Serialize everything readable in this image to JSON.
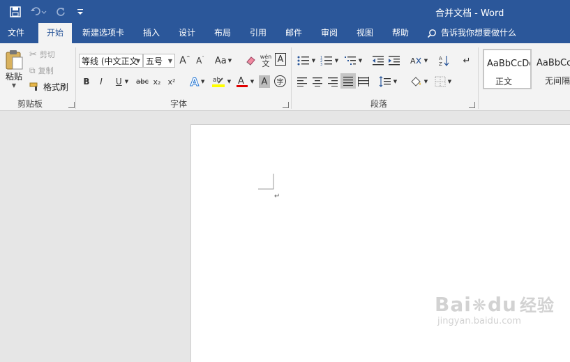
{
  "window": {
    "title": "合并文档  -  Word"
  },
  "qat": {
    "save_icon": "save-icon",
    "undo_icon": "undo-icon",
    "redo_icon": "redo-icon",
    "customize_icon": "customize-qat-icon"
  },
  "tabs": [
    {
      "label": "文件"
    },
    {
      "label": "开始",
      "active": true
    },
    {
      "label": "新建选项卡"
    },
    {
      "label": "插入"
    },
    {
      "label": "设计"
    },
    {
      "label": "布局"
    },
    {
      "label": "引用"
    },
    {
      "label": "邮件"
    },
    {
      "label": "审阅"
    },
    {
      "label": "视图"
    },
    {
      "label": "帮助"
    }
  ],
  "tellme": {
    "label": "告诉我你想要做什么"
  },
  "clipboard": {
    "paste_label": "粘贴",
    "cut_label": "剪切",
    "copy_label": "复制",
    "format_painter_label": "格式刷",
    "group_label": "剪贴板"
  },
  "font": {
    "font_name": "等线 (中文正文",
    "font_size": "五号",
    "change_case": "Aa",
    "phonetic_top": "wén",
    "phonetic_bottom": "文",
    "border_char": "A",
    "bold": "B",
    "italic": "I",
    "underline": "U",
    "strike": "abc",
    "subscript": "x₂",
    "superscript": "x²",
    "shading_char": "A",
    "enclose_char": "字",
    "group_label": "字体"
  },
  "paragraph": {
    "group_label": "段落"
  },
  "styles": {
    "items": [
      {
        "sample": "AaBbCcDd",
        "name": "正文"
      },
      {
        "sample": "AaBbCcDd",
        "name": "无间隔"
      }
    ]
  },
  "colors": {
    "accent": "#2b579a",
    "highlight": "#ffff00",
    "font_color": "#e00000"
  },
  "watermark": {
    "brand": "Bai",
    "brand2": "du",
    "brand_cn": "经验",
    "url": "jingyan.baidu.com"
  }
}
